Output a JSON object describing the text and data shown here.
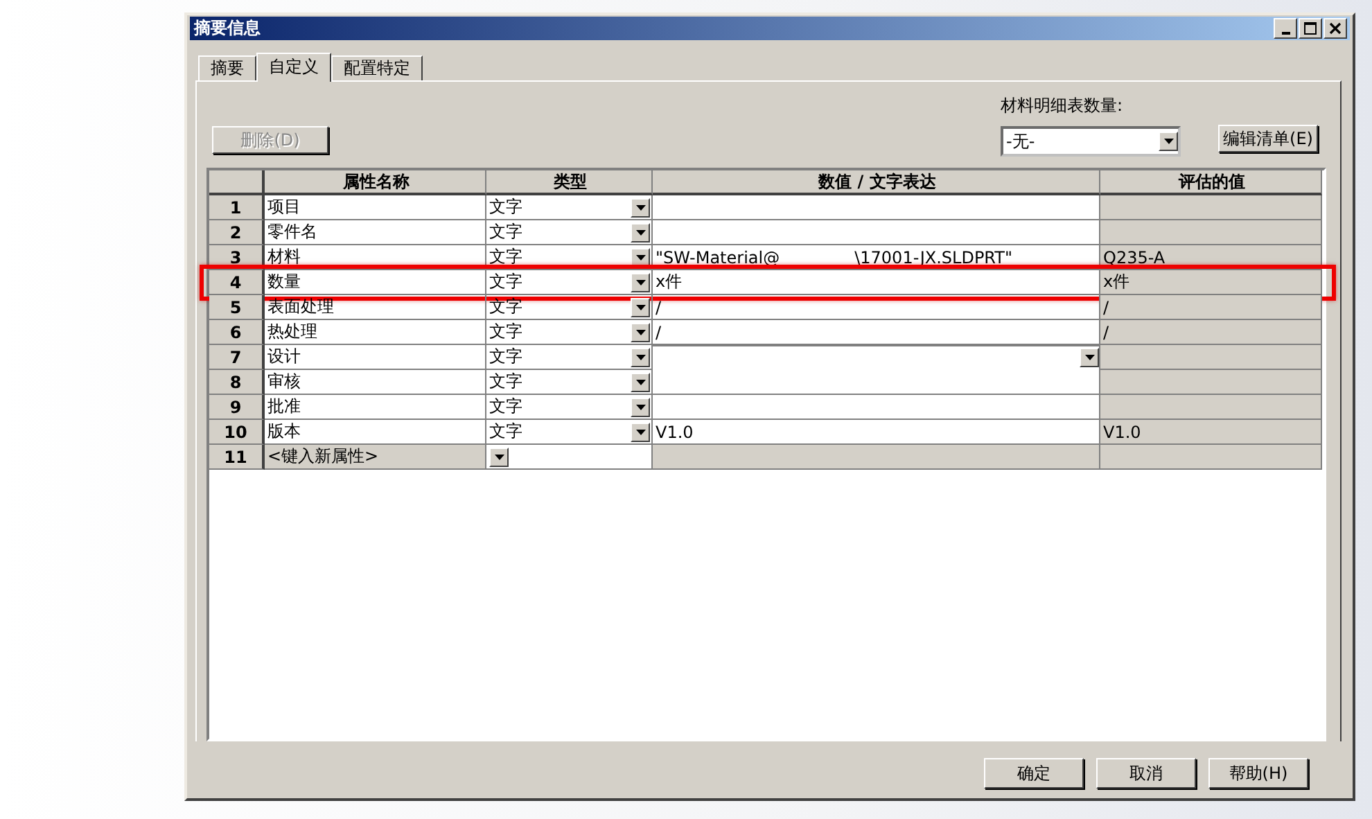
{
  "window": {
    "title": "摘要信息"
  },
  "tabs": [
    {
      "label": "摘要",
      "selected": false
    },
    {
      "label": "自定义",
      "selected": true
    },
    {
      "label": "配置特定",
      "selected": false
    }
  ],
  "delete_button": {
    "label": "删除(D)",
    "disabled": true
  },
  "bom_quantity": {
    "label": "材料明细表数量:",
    "value": "-无-"
  },
  "edit_list_button": {
    "label": "编辑清单(E)"
  },
  "table": {
    "columns": [
      "属性名称",
      "类型",
      "数值 / 文字表达",
      "评估的值"
    ],
    "rows": [
      {
        "number": "1",
        "name": "项目",
        "type": "文字",
        "value": [],
        "evaluated": ""
      },
      {
        "number": "2",
        "name": "零件名",
        "type": "文字",
        "value": [],
        "evaluated": ""
      },
      {
        "number": "3",
        "name": "材料",
        "type": "文字",
        "value": [
          "\"SW-Material@",
          "\\17001-JX.SLDPRT\""
        ],
        "evaluated": "Q235-A"
      },
      {
        "number": "4",
        "name": "数量",
        "type": "文字",
        "value": [
          "x件"
        ],
        "evaluated": "x件",
        "highlighted": true
      },
      {
        "number": "5",
        "name": "表面处理",
        "type": "文字",
        "value": [
          "/"
        ],
        "evaluated": "/"
      },
      {
        "number": "6",
        "name": "热处理",
        "type": "文字",
        "value": [
          "/"
        ],
        "evaluated": "/"
      },
      {
        "number": "7",
        "name": "设计",
        "type": "文字",
        "value": [],
        "evaluated": "",
        "editing": true
      },
      {
        "number": "8",
        "name": "审核",
        "type": "文字",
        "value": [],
        "evaluated": ""
      },
      {
        "number": "9",
        "name": "批准",
        "type": "文字",
        "value": [],
        "evaluated": ""
      },
      {
        "number": "10",
        "name": "版本",
        "type": "文字",
        "value": [
          "V1.0"
        ],
        "evaluated": "V1.0"
      },
      {
        "number": "11",
        "name": "<键入新属性>",
        "type": "",
        "value": [],
        "evaluated": "",
        "kind": "new"
      }
    ]
  },
  "buttons": [
    "确定",
    "取消",
    "帮助(H)"
  ]
}
